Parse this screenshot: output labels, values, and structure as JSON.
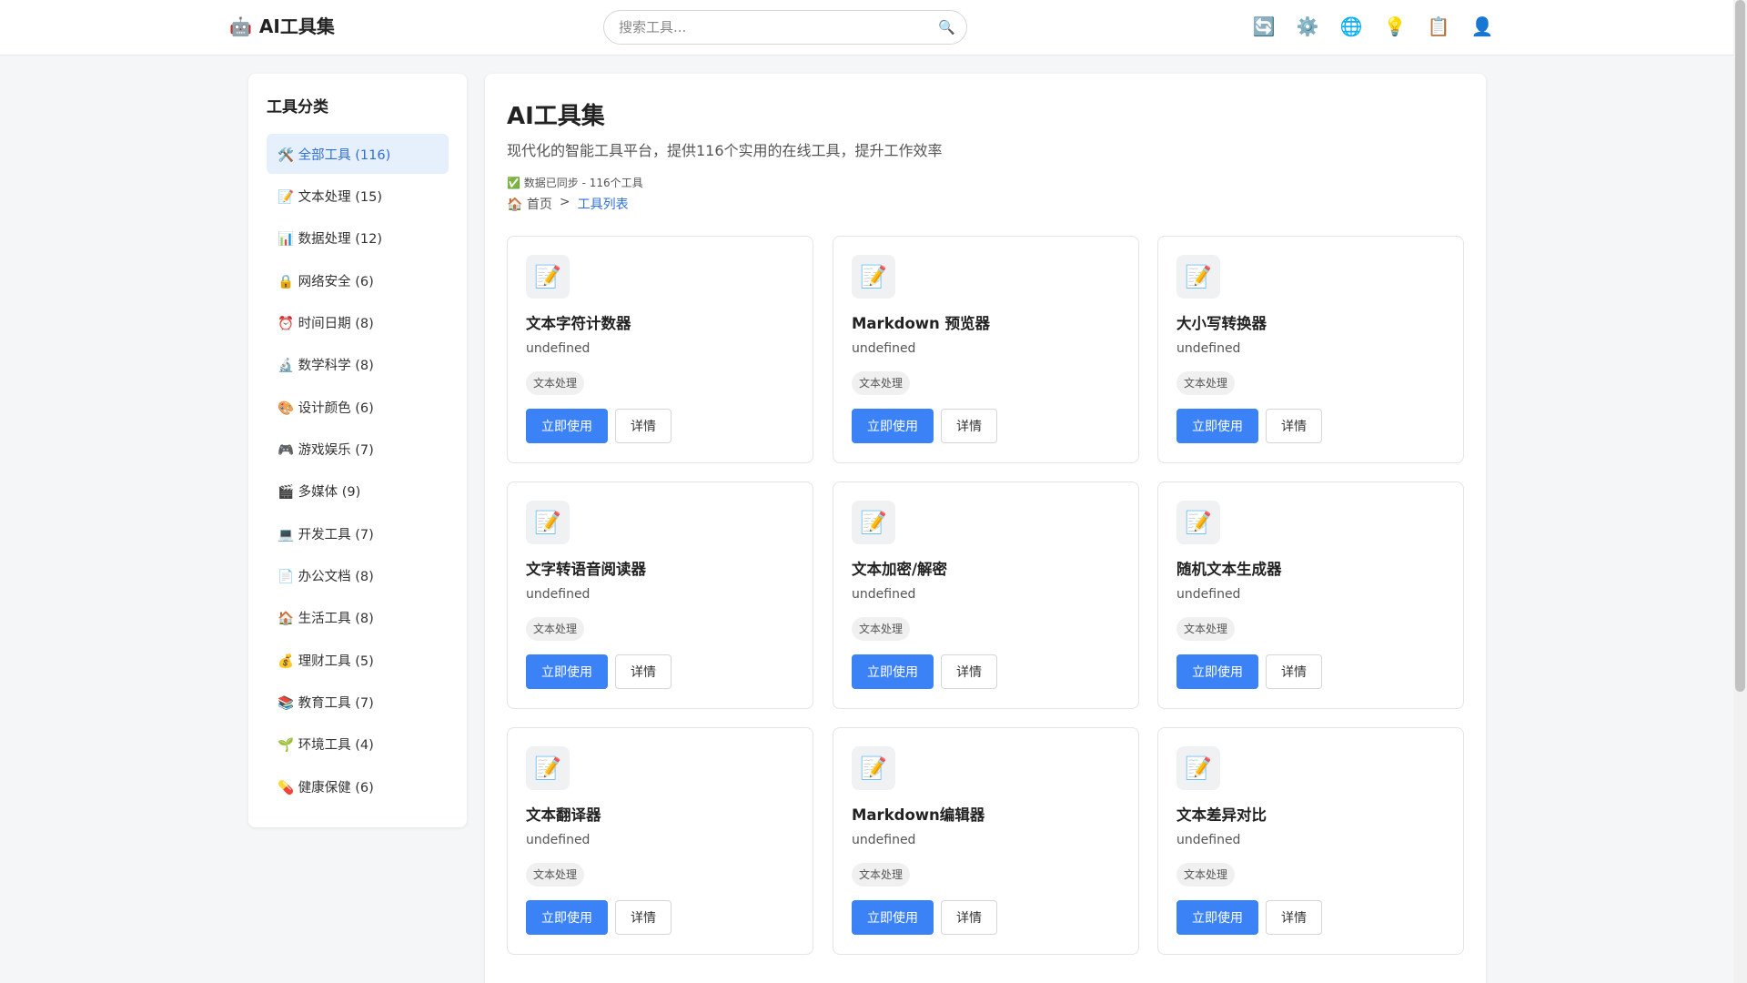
{
  "header": {
    "logo_icon": "🤖",
    "logo_text": "AI工具集",
    "search_placeholder": "搜索工具...",
    "search_icon": "🔍",
    "icons": [
      {
        "name": "refresh-icon",
        "glyph": "🔄"
      },
      {
        "name": "settings-icon",
        "glyph": "⚙️"
      },
      {
        "name": "language-icon",
        "glyph": "🌐"
      },
      {
        "name": "theme-icon",
        "glyph": "💡"
      },
      {
        "name": "clipboard-icon",
        "glyph": "📋"
      },
      {
        "name": "user-icon",
        "glyph": "👤"
      }
    ]
  },
  "sidebar": {
    "title": "工具分类",
    "items": [
      {
        "label": "🛠️ 全部工具 (116)",
        "active": true
      },
      {
        "label": "📝 文本处理 (15)"
      },
      {
        "label": "📊 数据处理 (12)"
      },
      {
        "label": "🔒 网络安全 (6)"
      },
      {
        "label": "⏰ 时间日期 (8)"
      },
      {
        "label": "🔬 数学科学 (8)"
      },
      {
        "label": "🎨 设计颜色 (6)"
      },
      {
        "label": "🎮 游戏娱乐 (7)"
      },
      {
        "label": "🎬 多媒体 (9)"
      },
      {
        "label": "💻 开发工具 (7)"
      },
      {
        "label": "📄 办公文档 (8)"
      },
      {
        "label": "🏠 生活工具 (8)"
      },
      {
        "label": "💰 理财工具 (5)"
      },
      {
        "label": "📚 教育工具 (7)"
      },
      {
        "label": "🌱 环境工具 (4)"
      },
      {
        "label": "💊 健康保健 (6)"
      }
    ]
  },
  "main": {
    "title": "AI工具集",
    "subtitle": "现代化的智能工具平台，提供116个实用的在线工具，提升工作效率",
    "sync_status": "✅ 数据已同步 - 116个工具",
    "breadcrumb": {
      "home": "🏠 首页",
      "separator": ">",
      "current": "工具列表"
    },
    "use_label": "立即使用",
    "detail_label": "详情",
    "cards": [
      {
        "icon": "📝",
        "title": "文本字符计数器",
        "desc": "undefined",
        "tag": "文本处理"
      },
      {
        "icon": "📝",
        "title": "Markdown 预览器",
        "desc": "undefined",
        "tag": "文本处理"
      },
      {
        "icon": "📝",
        "title": "大小写转换器",
        "desc": "undefined",
        "tag": "文本处理"
      },
      {
        "icon": "📝",
        "title": "文字转语音阅读器",
        "desc": "undefined",
        "tag": "文本处理"
      },
      {
        "icon": "📝",
        "title": "文本加密/解密",
        "desc": "undefined",
        "tag": "文本处理"
      },
      {
        "icon": "📝",
        "title": "随机文本生成器",
        "desc": "undefined",
        "tag": "文本处理"
      },
      {
        "icon": "📝",
        "title": "文本翻译器",
        "desc": "undefined",
        "tag": "文本处理"
      },
      {
        "icon": "📝",
        "title": "Markdown编辑器",
        "desc": "undefined",
        "tag": "文本处理"
      },
      {
        "icon": "📝",
        "title": "文本差异对比",
        "desc": "undefined",
        "tag": "文本处理"
      }
    ]
  }
}
